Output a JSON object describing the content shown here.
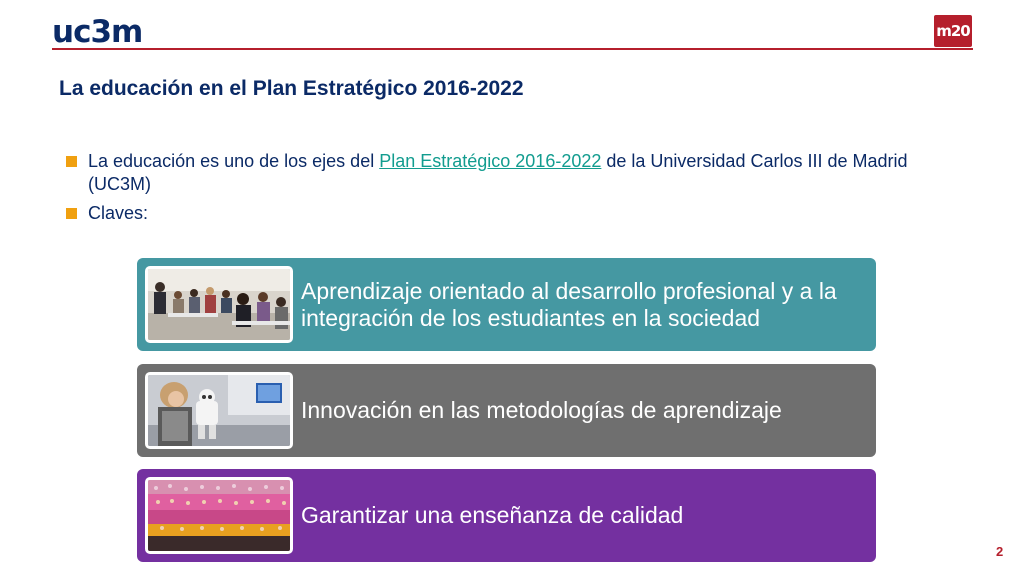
{
  "header": {
    "logo_left": "uc3m",
    "logo_right": "m20"
  },
  "title": "La educación en el Plan Estratégico 2016-2022",
  "bullets": [
    {
      "text_before": "La educación es uno de los ejes del ",
      "link": "Plan Estratégico 2016-2022",
      "text_after": " de la Universidad Carlos III de Madrid (UC3M)"
    },
    {
      "text": "Claves:"
    }
  ],
  "cards": [
    {
      "text": "Aprendizaje orientado al desarrollo profesional y a la integración de los estudiantes en la sociedad",
      "color": "#4598a2"
    },
    {
      "text": "Innovación en las metodologías de aprendizaje",
      "color": "#6f6f6f"
    },
    {
      "text": "Garantizar una enseñanza de calidad",
      "color": "#7430a0"
    }
  ],
  "colors": {
    "brand_navy": "#0b2a66",
    "brand_red": "#b51f2c",
    "bullet_orange": "#f0a010",
    "link_teal": "#129c8f"
  },
  "page_number": "2"
}
